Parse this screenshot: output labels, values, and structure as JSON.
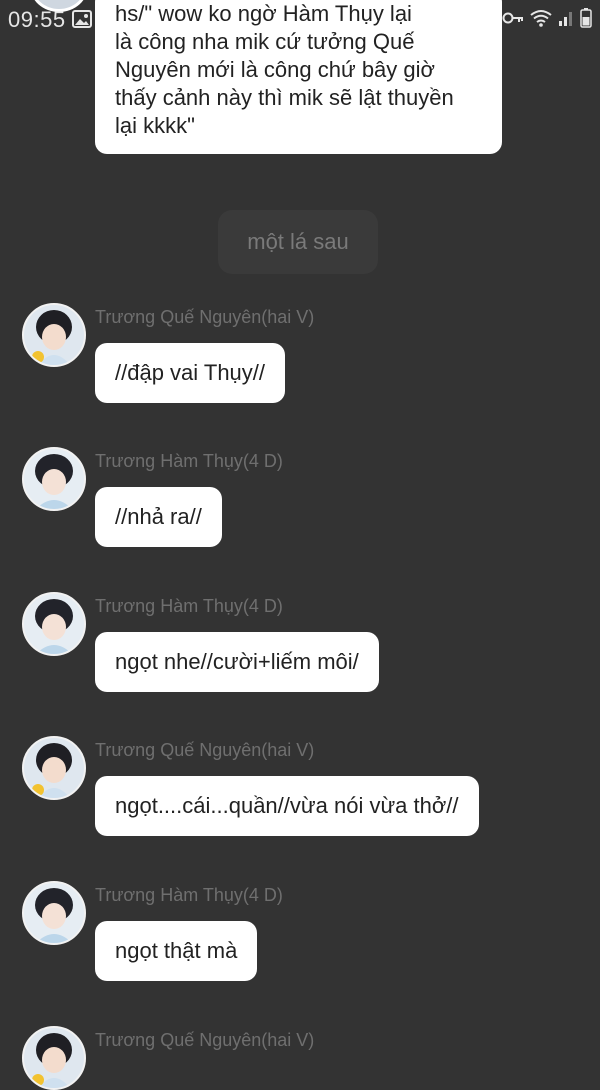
{
  "status_bar": {
    "time": "09:55",
    "icons": [
      "image-icon",
      "key-icon",
      "wifi-icon",
      "signal-icon",
      "battery-icon"
    ]
  },
  "top_bubble": {
    "text": "hs/\" wow ko ngờ Hàm Thụy lại\nlà công nha mik cứ tưởng Quế\nNguyên mới là công chứ bây giờ\nthấy cảnh này thì mik sẽ lật thuyền\nlại kkkk\""
  },
  "scene_divider": {
    "text": "một lá sau"
  },
  "messages": [
    {
      "sender": "Trương Quế Nguyên(hai V)",
      "text": "//đập vai Thụy//"
    },
    {
      "sender": "Trương Hàm Thụy(4 D)",
      "text": "//nhả ra//"
    },
    {
      "sender": "Trương Hàm Thụy(4 D)",
      "text": "ngọt nhe//cười+liếm môi/"
    },
    {
      "sender": "Trương Quế Nguyên(hai V)",
      "text": "ngọt....cái...quần//vừa nói vừa thở//"
    },
    {
      "sender": "Trương Hàm Thụy(4 D)",
      "text": "ngọt thật mà"
    },
    {
      "sender": "Trương Quế Nguyên(hai V)",
      "text": ""
    }
  ],
  "colors": {
    "background": "#333333",
    "bubble": "#ffffff",
    "sender_text": "#6f6f6f",
    "divider_pill": "#3a3a3a"
  }
}
